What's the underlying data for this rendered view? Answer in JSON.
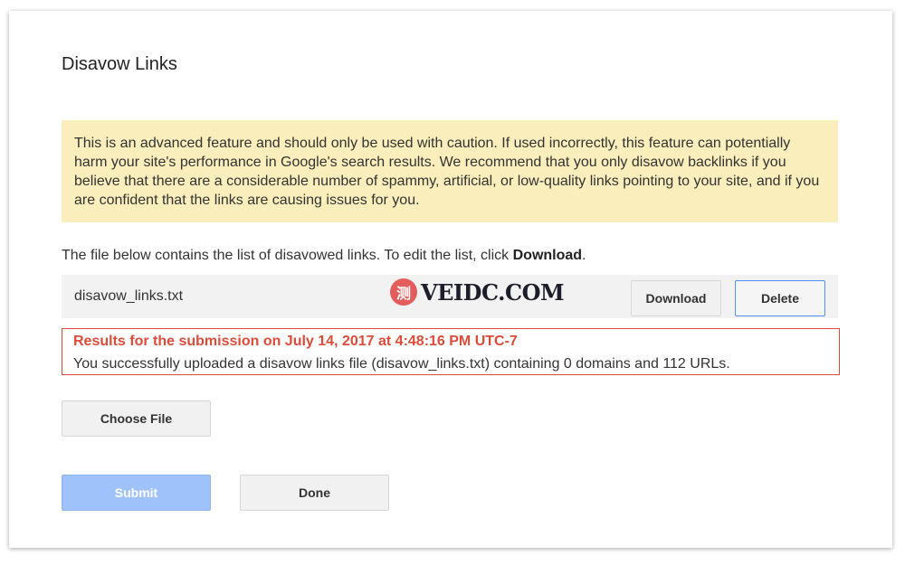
{
  "dialog": {
    "title": "Disavow Links",
    "warning_text": "This is an advanced feature and should only be used with caution. If used incorrectly, this feature can potentially harm your site's performance in Google's search results. We recommend that you only disavow backlinks if you believe that there are a considerable number of spammy, artificial, or low-quality links pointing to your site, and if you are confident that the links are causing issues for you.",
    "intro_text": "The file below contains the list of disavowed links. To edit the list, click ",
    "intro_emphasis": "Download",
    "intro_end": ".",
    "file": {
      "name": "disavow_links.txt",
      "download_label": "Download",
      "delete_label": "Delete"
    },
    "results": {
      "heading": "Results for the submission on July 14, 2017 at 4:48:16 PM UTC-7",
      "body": "You successfully uploaded a disavow links file (disavow_links.txt) containing 0 domains and 112 URLs."
    },
    "choose_file_label": "Choose File",
    "submit_label": "Submit",
    "done_label": "Done"
  },
  "watermark": {
    "badge": "测",
    "text": "VEIDC.COM"
  },
  "colors": {
    "warning_bg": "#f9eebc",
    "error_red": "#dd4b39",
    "accent_blue": "#4d90fe",
    "submit_disabled": "#a0c2fb"
  }
}
